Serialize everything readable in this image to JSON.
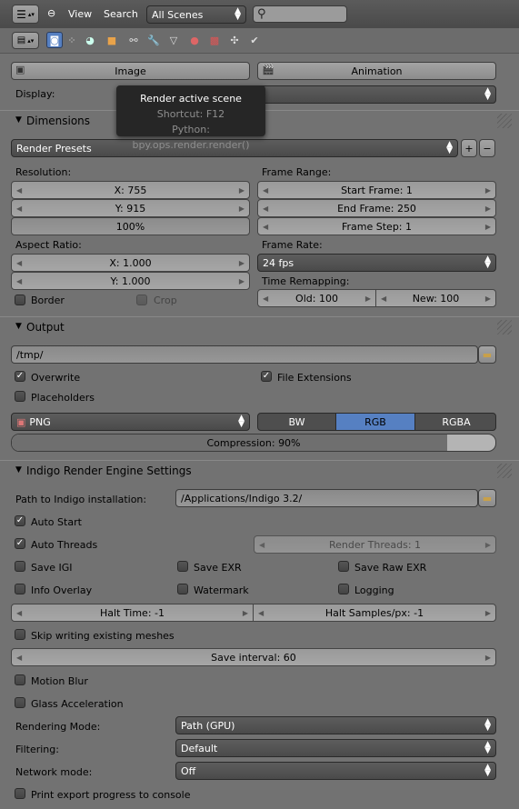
{
  "header": {
    "menus": [
      "View",
      "Search"
    ],
    "scene_selector": "All Scenes",
    "search": {
      "placeholder": "",
      "value": ""
    }
  },
  "render": {
    "image_label": "Image",
    "animation_label": "Animation",
    "display_label": "Display:"
  },
  "tooltip": {
    "title": "Render active scene",
    "shortcut": "Shortcut: F12",
    "python": "Python: bpy.ops.render.render()"
  },
  "dimensions": {
    "title": "Dimensions",
    "presets": "Render Presets",
    "resolution_label": "Resolution:",
    "res_x": "X: 755",
    "res_y": "Y: 915",
    "res_percent": "100%",
    "aspect_label": "Aspect Ratio:",
    "aspect_x": "X: 1.000",
    "aspect_y": "Y: 1.000",
    "border": "Border",
    "crop": "Crop",
    "frame_range_label": "Frame Range:",
    "start_frame": "Start Frame: 1",
    "end_frame": "End Frame: 250",
    "frame_step": "Frame Step: 1",
    "frame_rate_label": "Frame Rate:",
    "fps": "24 fps",
    "time_remap_label": "Time Remapping:",
    "old": "Old: 100",
    "new": "New: 100"
  },
  "output": {
    "title": "Output",
    "path": "/tmp/",
    "overwrite": "Overwrite",
    "file_extensions": "File Extensions",
    "placeholders": "Placeholders",
    "format": "PNG",
    "color_modes": [
      "BW",
      "RGB",
      "RGBA"
    ],
    "active_color_mode": "RGB",
    "compression": "Compression: 90%",
    "compression_level": 0.9
  },
  "indigo": {
    "title": "Indigo Render Engine Settings",
    "path_label": "Path to Indigo installation:",
    "path": "/Applications/Indigo 3.2/",
    "auto_start": "Auto Start",
    "auto_threads": "Auto Threads",
    "render_threads": "Render Threads: 1",
    "save_igi": "Save IGI",
    "save_exr": "Save EXR",
    "save_raw_exr": "Save Raw EXR",
    "info_overlay": "Info Overlay",
    "watermark": "Watermark",
    "logging": "Logging",
    "halt_time": "Halt Time: -1",
    "halt_samples": "Halt Samples/px: -1",
    "skip_meshes": "Skip writing existing meshes",
    "save_interval": "Save interval: 60",
    "motion_blur": "Motion Blur",
    "glass_accel": "Glass Acceleration",
    "rendering_mode_label": "Rendering Mode:",
    "rendering_mode": "Path (GPU)",
    "filtering_label": "Filtering:",
    "filtering": "Default",
    "network_label": "Network mode:",
    "network": "Off",
    "print_progress": "Print export progress to console"
  },
  "colors": {
    "accent": "#5680c2",
    "panel": "#727272",
    "tooltip_bg": "#262626"
  }
}
